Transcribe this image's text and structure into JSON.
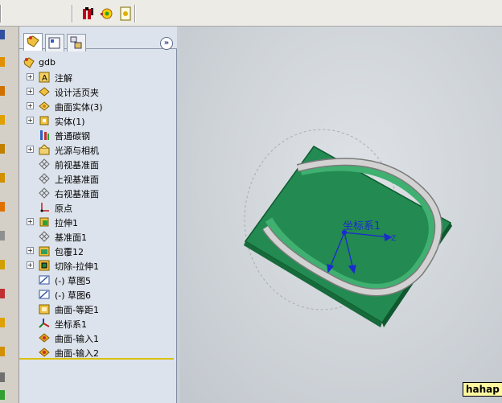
{
  "feature_tree": {
    "root": "gdb",
    "items": [
      {
        "label": "注解",
        "expandable": true,
        "icon": "annotation-icon"
      },
      {
        "label": "设计活页夹",
        "expandable": true,
        "icon": "design-binder-icon"
      },
      {
        "label": "曲面实体(3)",
        "expandable": true,
        "icon": "surface-bodies-icon"
      },
      {
        "label": "实体(1)",
        "expandable": true,
        "icon": "solid-bodies-icon"
      },
      {
        "label": "普通碳钢",
        "expandable": false,
        "icon": "material-icon"
      },
      {
        "label": "光源与相机",
        "expandable": true,
        "icon": "lights-camera-icon"
      },
      {
        "label": "前视基准面",
        "expandable": false,
        "icon": "plane-icon"
      },
      {
        "label": "上视基准面",
        "expandable": false,
        "icon": "plane-icon"
      },
      {
        "label": "右视基准面",
        "expandable": false,
        "icon": "plane-icon"
      },
      {
        "label": "原点",
        "expandable": false,
        "icon": "origin-icon"
      },
      {
        "label": "拉伸1",
        "expandable": true,
        "icon": "extrude-icon"
      },
      {
        "label": "基准面1",
        "expandable": false,
        "icon": "plane-icon"
      },
      {
        "label": "包覆12",
        "expandable": true,
        "icon": "wrap-icon"
      },
      {
        "label": "切除-拉伸1",
        "expandable": true,
        "icon": "cut-extrude-icon"
      },
      {
        "label": "(-) 草图5",
        "expandable": false,
        "icon": "sketch-icon"
      },
      {
        "label": "(-) 草图6",
        "expandable": false,
        "icon": "sketch-icon"
      },
      {
        "label": "曲面-等距1",
        "expandable": false,
        "icon": "surface-offset-icon"
      },
      {
        "label": "坐标系1",
        "expandable": false,
        "icon": "coordinate-system-icon"
      },
      {
        "label": "曲面-输入1",
        "expandable": false,
        "icon": "imported-surface-icon"
      },
      {
        "label": "曲面-输入2",
        "expandable": false,
        "icon": "imported-surface-icon"
      }
    ]
  },
  "viewport": {
    "coordinate_label": "坐标系1",
    "axis_z": "Z"
  },
  "watermark": "hahap",
  "colors": {
    "plate": "#238a52",
    "ring": "#c8c8c8",
    "panel_bg": "#dde3ec",
    "axis": "#1a2ad0"
  }
}
